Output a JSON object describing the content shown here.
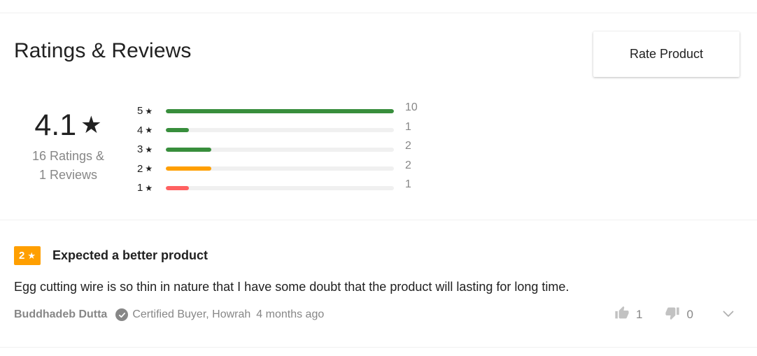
{
  "ratings": {
    "title": "Ratings & Reviews",
    "rate_button_label": "Rate Product",
    "average": "4.1",
    "star_glyph": "★",
    "ratings_count_text": "16 Ratings &",
    "reviews_count_text": "1 Reviews",
    "distribution": [
      {
        "stars": "5",
        "count": "10",
        "fraction": 1.0,
        "color": "#388e3c"
      },
      {
        "stars": "4",
        "count": "1",
        "fraction": 0.1,
        "color": "#388e3c"
      },
      {
        "stars": "3",
        "count": "2",
        "fraction": 0.2,
        "color": "#388e3c"
      },
      {
        "stars": "2",
        "count": "2",
        "fraction": 0.2,
        "color": "#ff9f00"
      },
      {
        "stars": "1",
        "count": "1",
        "fraction": 0.1,
        "color": "#ff6161"
      }
    ]
  },
  "review": {
    "rating": "2",
    "badge_color": "#ff9f00",
    "title": "Expected a better product",
    "body": "Egg cutting wire is so thin in nature that I have some doubt that the product will lasting for long time.",
    "reviewer": "Buddhadeb Dutta",
    "certified_text": "Certified Buyer, Howrah",
    "time_ago": "4 months ago",
    "likes": "1",
    "dislikes": "0",
    "icons": {
      "verified": "check-circle-icon",
      "like": "thumbs-up-icon",
      "dislike": "thumbs-down-icon",
      "expand": "chevron-down-icon"
    }
  }
}
